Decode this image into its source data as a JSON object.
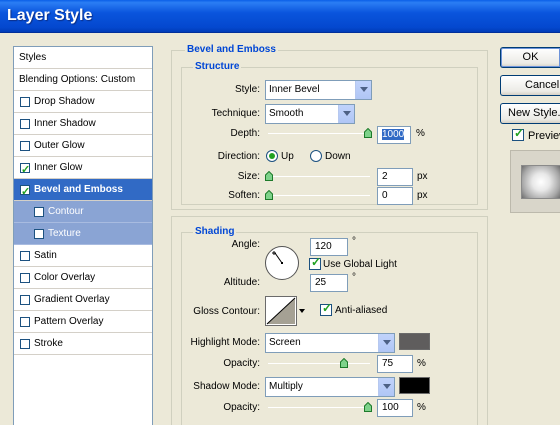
{
  "window": {
    "title": "Layer Style"
  },
  "styles_list": {
    "header": "Styles",
    "blending": "Blending Options: Custom",
    "items": [
      {
        "label": "Drop Shadow",
        "checked": false
      },
      {
        "label": "Inner Shadow",
        "checked": false
      },
      {
        "label": "Outer Glow",
        "checked": false
      },
      {
        "label": "Inner Glow",
        "checked": true
      },
      {
        "label": "Bevel and Emboss",
        "checked": true
      },
      {
        "label": "Contour",
        "checked": false
      },
      {
        "label": "Texture",
        "checked": false
      },
      {
        "label": "Satin",
        "checked": false
      },
      {
        "label": "Color Overlay",
        "checked": false
      },
      {
        "label": "Gradient Overlay",
        "checked": false
      },
      {
        "label": "Pattern Overlay",
        "checked": false
      },
      {
        "label": "Stroke",
        "checked": false
      }
    ]
  },
  "bevel": {
    "title": "Bevel and Emboss",
    "structure": {
      "title": "Structure",
      "style_label": "Style:",
      "style_value": "Inner Bevel",
      "technique_label": "Technique:",
      "technique_value": "Smooth",
      "depth_label": "Depth:",
      "depth_value": "1000",
      "depth_unit": "%",
      "direction_label": "Direction:",
      "direction_up": "Up",
      "direction_down": "Down",
      "direction_selected": "Up",
      "size_label": "Size:",
      "size_value": "2",
      "size_unit": "px",
      "soften_label": "Soften:",
      "soften_value": "0",
      "soften_unit": "px"
    },
    "shading": {
      "title": "Shading",
      "angle_label": "Angle:",
      "angle_value": "120",
      "angle_unit": "°",
      "use_global_light": "Use Global Light",
      "use_global_light_checked": true,
      "altitude_label": "Altitude:",
      "altitude_value": "25",
      "altitude_unit": "°",
      "gloss_contour_label": "Gloss Contour:",
      "anti_aliased": "Anti-aliased",
      "anti_aliased_checked": true,
      "highlight_mode_label": "Highlight Mode:",
      "highlight_mode_value": "Screen",
      "highlight_color": "#5f5d5d",
      "highlight_opacity_label": "Opacity:",
      "highlight_opacity_value": "75",
      "highlight_opacity_unit": "%",
      "shadow_mode_label": "Shadow Mode:",
      "shadow_mode_value": "Multiply",
      "shadow_color": "#000000",
      "shadow_opacity_label": "Opacity:",
      "shadow_opacity_value": "100",
      "shadow_opacity_unit": "%"
    }
  },
  "buttons": {
    "ok": "OK",
    "cancel": "Cancel",
    "new_style": "New Style...",
    "preview": "Preview",
    "preview_checked": true
  }
}
